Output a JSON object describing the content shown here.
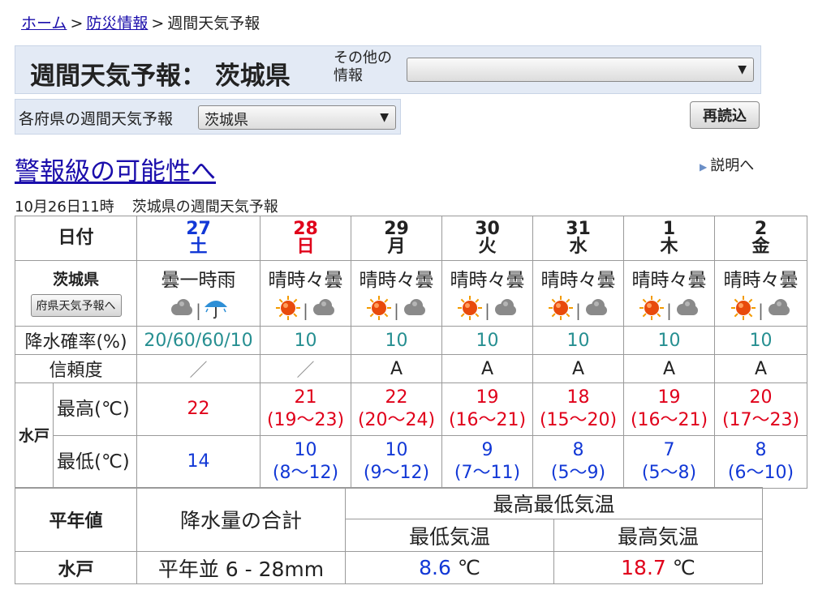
{
  "breadcrumb": {
    "home": "ホーム",
    "disaster": "防災情報",
    "current": "週間天気予報",
    "sep": ">"
  },
  "header": {
    "title": "週間天気予報： 茨城県",
    "other_label": "その他の情報",
    "other_value": ""
  },
  "prefbar": {
    "label": "各府県の週間天気予報",
    "selected": "茨城県"
  },
  "reload_label": "再読込",
  "warning_link": "警報級の可能性へ",
  "explain_link": "説明へ",
  "issued": {
    "time": "10月26日11時",
    "title": "茨城県の週間天気予報"
  },
  "table": {
    "date_label": "日付",
    "pref_label": "茨城県",
    "pref_button": "府県天気予報へ",
    "pop_label": "降水確率(%)",
    "rel_label": "信頼度",
    "city": "水戸",
    "max_label": "最高(℃)",
    "min_label": "最低(℃)",
    "days": [
      {
        "day": "27",
        "wd": "土",
        "color": "#1238d6",
        "weather": "曇一時雨",
        "icons": [
          "cloud-icon",
          "umbrella-icon"
        ],
        "pop": "20/60/60/10",
        "rel": "／",
        "max": "22",
        "max_range": "",
        "min": "14",
        "min_range": ""
      },
      {
        "day": "28",
        "wd": "日",
        "color": "#e0001a",
        "weather": "晴時々曇",
        "icons": [
          "sun-icon",
          "cloud-icon"
        ],
        "pop": "10",
        "rel": "／",
        "max": "21",
        "max_range": "(19～23)",
        "min": "10",
        "min_range": "(8～12)"
      },
      {
        "day": "29",
        "wd": "月",
        "color": "#222",
        "weather": "晴時々曇",
        "icons": [
          "sun-icon",
          "cloud-icon"
        ],
        "pop": "10",
        "rel": "A",
        "max": "22",
        "max_range": "(20～24)",
        "min": "10",
        "min_range": "(9～12)"
      },
      {
        "day": "30",
        "wd": "火",
        "color": "#222",
        "weather": "晴時々曇",
        "icons": [
          "sun-icon",
          "cloud-icon"
        ],
        "pop": "10",
        "rel": "A",
        "max": "19",
        "max_range": "(16～21)",
        "min": "9",
        "min_range": "(7～11)"
      },
      {
        "day": "31",
        "wd": "水",
        "color": "#222",
        "weather": "晴時々曇",
        "icons": [
          "sun-icon",
          "cloud-icon"
        ],
        "pop": "10",
        "rel": "A",
        "max": "18",
        "max_range": "(15～20)",
        "min": "8",
        "min_range": "(5～9)"
      },
      {
        "day": "1",
        "wd": "木",
        "color": "#222",
        "weather": "晴時々曇",
        "icons": [
          "sun-icon",
          "cloud-icon"
        ],
        "pop": "10",
        "rel": "A",
        "max": "19",
        "max_range": "(16～21)",
        "min": "7",
        "min_range": "(5～8)"
      },
      {
        "day": "2",
        "wd": "金",
        "color": "#222",
        "weather": "晴時々曇",
        "icons": [
          "sun-icon",
          "cloud-icon"
        ],
        "pop": "10",
        "rel": "A",
        "max": "20",
        "max_range": "(17～23)",
        "min": "8",
        "min_range": "(6～10)"
      }
    ]
  },
  "normals": {
    "label": "平年値",
    "precip_header": "降水量の合計",
    "temp_header": "最高最低気温",
    "min_header": "最低気温",
    "max_header": "最高気温",
    "city": "水戸",
    "precip": "平年並 6 - 28mm",
    "min_value": "8.6",
    "max_value": "18.7",
    "unit": "℃"
  }
}
